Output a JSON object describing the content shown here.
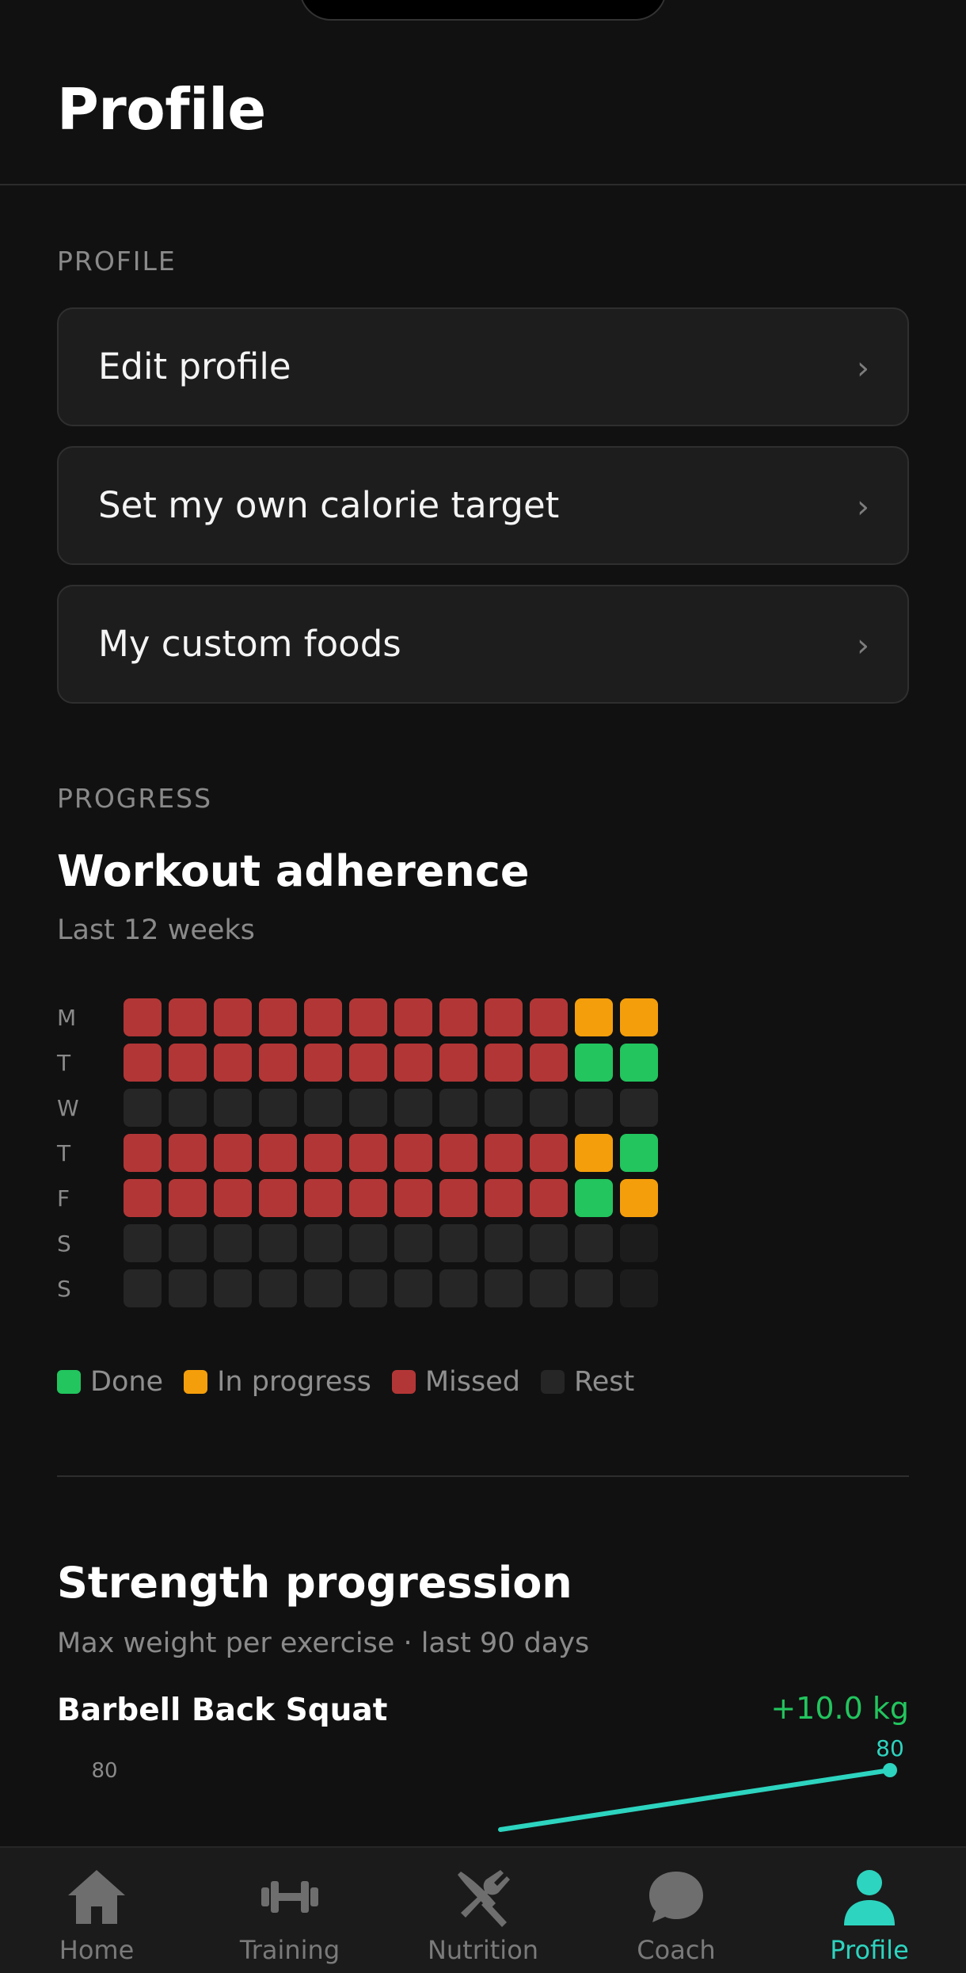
{
  "header": {
    "title": "Profile"
  },
  "profile_section": {
    "label": "PROFILE",
    "items": [
      {
        "label": "Edit profile",
        "chevron": "›"
      },
      {
        "label": "Set my own calorie target",
        "chevron": "›"
      },
      {
        "label": "My custom foods",
        "chevron": "›"
      }
    ]
  },
  "progress_section": {
    "label": "PROGRESS",
    "adherence": {
      "title": "Workout adherence",
      "subtitle": "Last 12 weeks",
      "days": [
        "M",
        "T",
        "W",
        "T",
        "F",
        "S",
        "S"
      ],
      "grid": [
        [
          "missed",
          "missed",
          "missed",
          "missed",
          "missed",
          "missed",
          "missed",
          "missed",
          "missed",
          "missed",
          "progress",
          "progress"
        ],
        [
          "missed",
          "missed",
          "missed",
          "missed",
          "missed",
          "missed",
          "missed",
          "missed",
          "missed",
          "missed",
          "done",
          "done"
        ],
        [
          "rest",
          "rest",
          "rest",
          "rest",
          "rest",
          "rest",
          "rest",
          "rest",
          "rest",
          "rest",
          "rest",
          "rest"
        ],
        [
          "missed",
          "missed",
          "missed",
          "missed",
          "missed",
          "missed",
          "missed",
          "missed",
          "missed",
          "missed",
          "progress",
          "done"
        ],
        [
          "missed",
          "missed",
          "missed",
          "missed",
          "missed",
          "missed",
          "missed",
          "missed",
          "missed",
          "missed",
          "done",
          "progress"
        ],
        [
          "rest",
          "rest",
          "rest",
          "rest",
          "rest",
          "rest",
          "rest",
          "rest",
          "rest",
          "rest",
          "rest",
          "future"
        ],
        [
          "rest",
          "rest",
          "rest",
          "rest",
          "rest",
          "rest",
          "rest",
          "rest",
          "rest",
          "rest",
          "rest",
          "future"
        ]
      ],
      "legend": [
        {
          "key": "done",
          "label": "Done"
        },
        {
          "key": "progress",
          "label": "In progress"
        },
        {
          "key": "missed",
          "label": "Missed"
        },
        {
          "key": "rest",
          "label": "Rest"
        }
      ],
      "colors": {
        "done": "#22c55e",
        "progress": "#f59e0b",
        "missed": "#b33636",
        "rest": "#262626",
        "future": "#1c1c1c"
      }
    },
    "strength": {
      "title": "Strength progression",
      "subtitle": "Max weight per exercise · last 90 days",
      "exercise": {
        "name": "Barbell Back Squat",
        "delta": "+10.0 kg"
      }
    }
  },
  "chart_data": {
    "type": "line",
    "x": [
      1,
      2
    ],
    "series": [
      {
        "values": [
          70,
          80
        ]
      }
    ],
    "y_tick_labels": [
      "80"
    ],
    "point_labels": [
      "80"
    ],
    "ylim": [
      60,
      80
    ],
    "line_color": "#2dd4bf"
  },
  "tabbar": {
    "tabs": [
      {
        "label": "Home",
        "icon": "home-icon",
        "active": false
      },
      {
        "label": "Training",
        "icon": "dumbbell-icon",
        "active": false
      },
      {
        "label": "Nutrition",
        "icon": "fork-knife-icon",
        "active": false
      },
      {
        "label": "Coach",
        "icon": "chat-bubble-icon",
        "active": false
      },
      {
        "label": "Profile",
        "icon": "person-icon",
        "active": true
      }
    ],
    "active_color": "#2dd4bf",
    "inactive_color": "#7a7a7a"
  }
}
